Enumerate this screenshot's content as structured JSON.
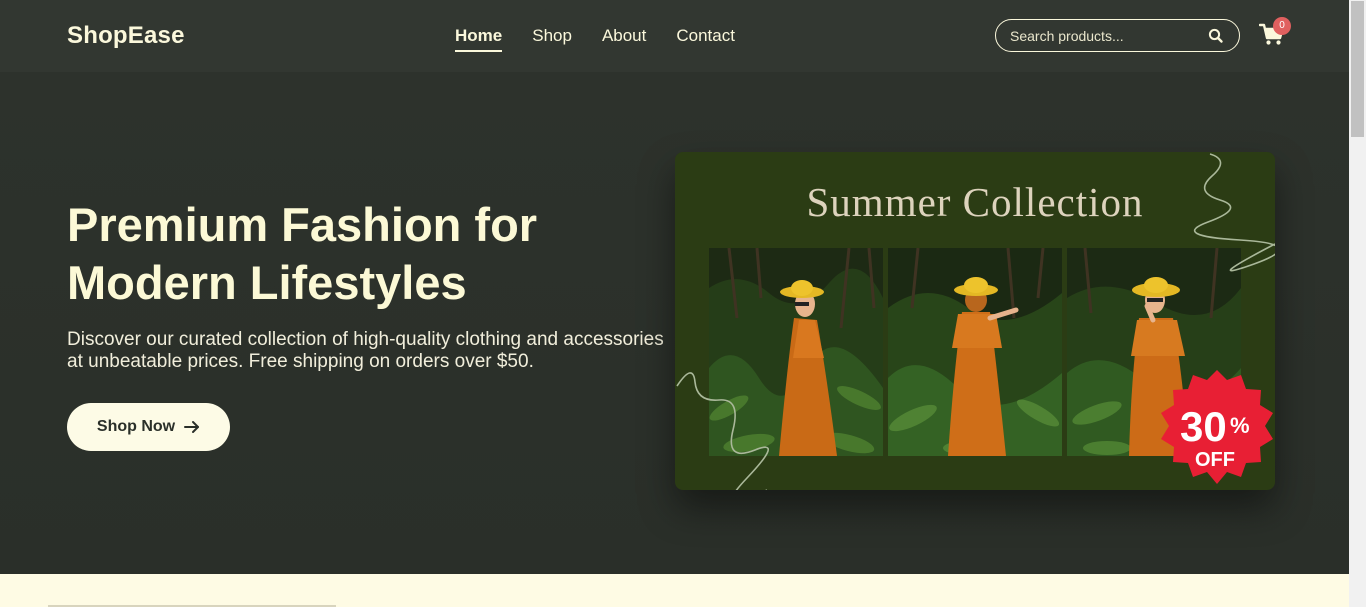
{
  "header": {
    "logo": "ShopEase",
    "nav": [
      {
        "label": "Home",
        "active": true
      },
      {
        "label": "Shop",
        "active": false
      },
      {
        "label": "About",
        "active": false
      },
      {
        "label": "Contact",
        "active": false
      }
    ],
    "search_placeholder": "Search products...",
    "search_icon": "search-icon",
    "cart_icon": "cart-icon",
    "cart_count": "0"
  },
  "hero": {
    "title_line1": "Premium Fashion for",
    "title_line2": "Modern Lifestyles",
    "description": "Discover our curated collection of high-quality clothing and accessories at unbeatable prices. Free shipping on orders over $50.",
    "cta_label": "Shop Now",
    "cta_icon": "arrow-right-icon"
  },
  "banner": {
    "title": "Summer Collection",
    "discount_value": "30",
    "discount_unit": "%",
    "discount_suffix": "OFF"
  },
  "colors": {
    "background": "#2a2f29",
    "header": "#323731",
    "text_light": "#fbf8dc",
    "banner_green": "#2b3c14",
    "badge_red": "#e81f34",
    "cart_badge": "#e0605f",
    "cta_bg": "#fdfbe6"
  }
}
